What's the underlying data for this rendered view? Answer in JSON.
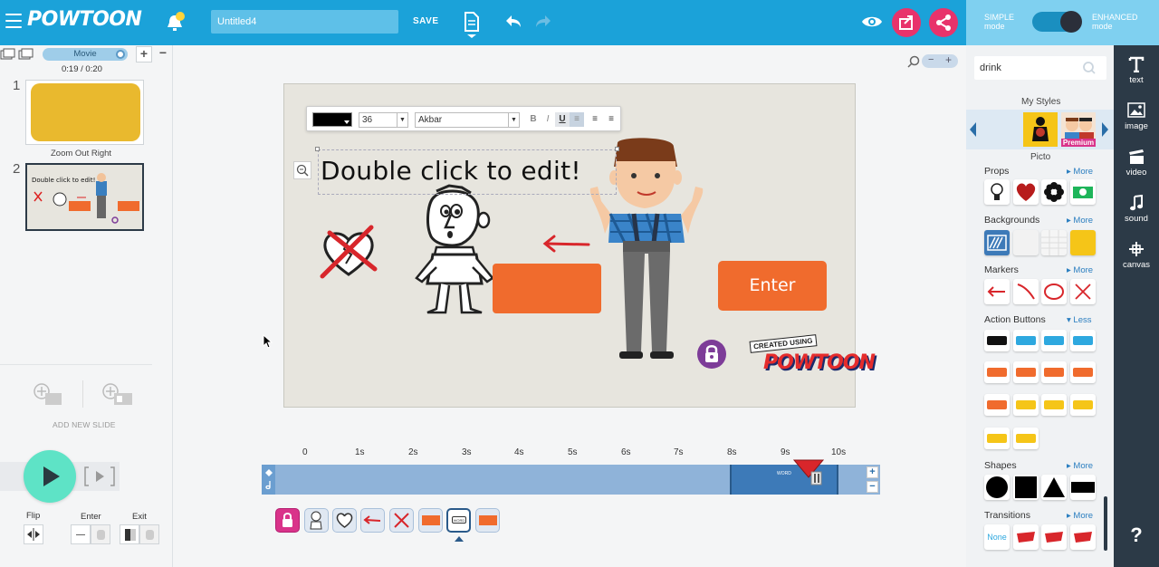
{
  "app": {
    "logo": "POWTOON",
    "title_value": "Untitled4",
    "save_label": "SAVE",
    "simple_mode": "SIMPLE\nmode",
    "enhanced_mode": "ENHANCED\nmode",
    "simple_mode_l1": "SIMPLE",
    "simple_mode_l2": "mode",
    "enhanced_mode_l1": "ENHANCED",
    "enhanced_mode_l2": "mode"
  },
  "slides_panel": {
    "movie_label": "Movie",
    "time": "0:19 / 0:20",
    "slides": [
      {
        "num": "1"
      },
      {
        "num": "2",
        "caption": "Zoom Out Right"
      }
    ],
    "add_new_slide": "ADD NEW SLIDE",
    "flip_label": "Flip",
    "enter_label": "Enter",
    "exit_label": "Exit"
  },
  "editor": {
    "font_size": "36",
    "font_name": "Akbar",
    "text_content": "Double click to edit!",
    "enter_button": "Enter",
    "created_using": "CREATED USING",
    "powtoon_stamp": "POWTOON"
  },
  "timeline": {
    "ticks": [
      "0",
      "1s",
      "2s",
      "3s",
      "4s",
      "5s",
      "6s",
      "7s",
      "8s",
      "9s",
      "10s"
    ]
  },
  "library": {
    "search_value": "drink",
    "my_styles": "My Styles",
    "premium": "Premium",
    "style_name": "Picto",
    "categories": [
      {
        "name": "Props",
        "link": "More"
      },
      {
        "name": "Backgrounds",
        "link": "More"
      },
      {
        "name": "Markers",
        "link": "More"
      },
      {
        "name": "Action Buttons",
        "link": "Less"
      },
      {
        "name": "Shapes",
        "link": "More"
      },
      {
        "name": "Transitions",
        "link": "More"
      }
    ],
    "transition_none": "None"
  },
  "tools": [
    {
      "label": "text",
      "icon": "text-icon"
    },
    {
      "label": "image",
      "icon": "image-icon"
    },
    {
      "label": "video",
      "icon": "video-icon"
    },
    {
      "label": "sound",
      "icon": "sound-icon"
    },
    {
      "label": "canvas",
      "icon": "canvas-icon"
    }
  ],
  "help": "?"
}
